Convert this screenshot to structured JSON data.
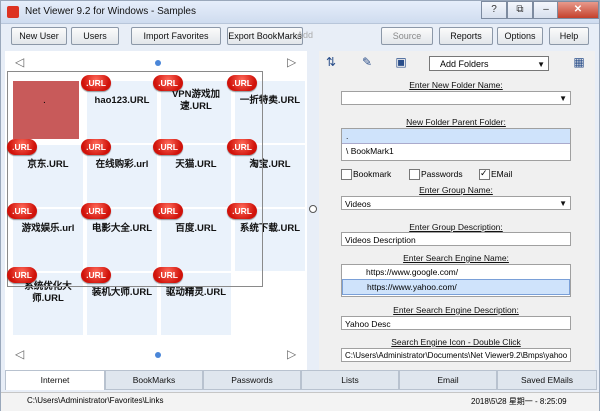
{
  "window": {
    "title": "Net Viewer 9.2 for Windows - Samples",
    "controls": {
      "help": "?",
      "restore": "⧉",
      "minimize": "–",
      "maximize": "□",
      "close": "✕"
    }
  },
  "toolbar": {
    "new_user": "New User",
    "users": "Users",
    "import_favorites": "Import Favorites",
    "export_bookmarks": "Export BookMarks",
    "ghost_add": "Add",
    "source": "Source",
    "reports": "Reports",
    "options": "Options",
    "help": "Help"
  },
  "grid": {
    "badge_text": ".URL",
    "selected_dot": ".",
    "tiles": [
      "hao123.URL",
      "VPN游戏加速.URL",
      "一折特卖.URL",
      "京东.URL",
      "在线购彩.url",
      "天猫.URL",
      "淘宝.URL",
      "游戏娱乐.url",
      "电影大全.URL",
      "百度.URL",
      "系统下载.URL",
      "系统优化大师.URL",
      "装机大师.URL",
      "驱动精灵.URL"
    ]
  },
  "right": {
    "add_folders_dropdown": "Add Folders",
    "new_folder_name_label": "Enter New Folder Name:",
    "new_folder_name_value": "",
    "parent_folder_label": "New Folder Parent Folder:",
    "parent_folder_items": [
      ".",
      "\\ BookMark1"
    ],
    "bookmark_chk": "Bookmark",
    "passwords_chk": "Passwords",
    "email_chk": "EMail",
    "checkmark": "✓",
    "group_name_label": "Enter Group Name:",
    "group_name_value": "Videos",
    "group_desc_label": "Enter Group Description:",
    "group_desc_value": "Videos Description",
    "search_engine_label": "Enter Search Engine Name:",
    "search_engines": [
      "https://www.google.com/",
      "https://www.yahoo.com/"
    ],
    "search_desc_label": "Enter Search Engine Description:",
    "search_desc_value": "Yahoo Desc",
    "search_icon_label": "Search Engine Icon - Double Click",
    "search_icon_value": "C:\\Users\\Administrator\\Documents\\Net Viewer9.2\\Bmps\\yahoo"
  },
  "tabs": [
    "Internet",
    "BookMarks",
    "Passwords",
    "Lists",
    "Email",
    "Saved EMails"
  ],
  "status": {
    "path": "C:\\Users\\Administrator\\Favorites\\Links",
    "datetime": "2018\\5\\28 星期一 - 8:25:09"
  }
}
